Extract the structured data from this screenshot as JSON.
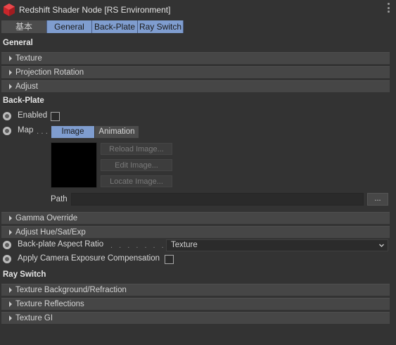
{
  "header": {
    "title": "Redshift Shader Node [RS Environment]",
    "icon": "redshift-cube-icon",
    "menu_icon": "vertical-dots-icon"
  },
  "tabs": [
    {
      "label": "基本",
      "active": false
    },
    {
      "label": "General",
      "active": true
    },
    {
      "label": "Back-Plate",
      "active": true
    },
    {
      "label": "Ray Switch",
      "active": true
    }
  ],
  "general": {
    "title": "General",
    "groups": [
      "Texture",
      "Projection Rotation",
      "Adjust"
    ]
  },
  "backplate": {
    "title": "Back-Plate",
    "enabled_label": "Enabled",
    "map_label": "Map",
    "map_dots": ". . .",
    "map_tabs": [
      "Image",
      "Animation"
    ],
    "image_buttons": [
      "Reload Image...",
      "Edit Image...",
      "Locate Image..."
    ],
    "path_label": "Path",
    "path_value": "",
    "browse_label": "...",
    "groups": [
      "Gamma Override",
      "Adjust Hue/Sat/Exp"
    ],
    "aspect_label": "Back-plate Aspect Ratio",
    "aspect_dots": ". . . . . . . . . . . .",
    "aspect_value": "Texture",
    "exposure_label": "Apply Camera Exposure Compensation"
  },
  "rayswitch": {
    "title": "Ray Switch",
    "groups": [
      "Texture Background/Refraction",
      "Texture Reflections",
      "Texture GI"
    ]
  },
  "colors": {
    "background": "#333333",
    "accent": "#7f9dcf",
    "group_row": "#464646"
  }
}
